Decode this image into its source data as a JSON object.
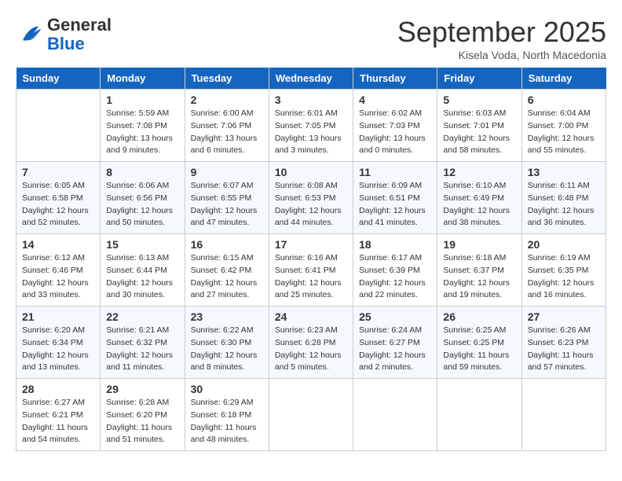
{
  "header": {
    "logo": {
      "line1": "General",
      "line2": "Blue"
    },
    "month": "September 2025",
    "location": "Kisela Voda, North Macedonia"
  },
  "days_of_week": [
    "Sunday",
    "Monday",
    "Tuesday",
    "Wednesday",
    "Thursday",
    "Friday",
    "Saturday"
  ],
  "weeks": [
    [
      {
        "day": "",
        "info": ""
      },
      {
        "day": "1",
        "info": "Sunrise: 5:59 AM\nSunset: 7:08 PM\nDaylight: 13 hours\nand 9 minutes."
      },
      {
        "day": "2",
        "info": "Sunrise: 6:00 AM\nSunset: 7:06 PM\nDaylight: 13 hours\nand 6 minutes."
      },
      {
        "day": "3",
        "info": "Sunrise: 6:01 AM\nSunset: 7:05 PM\nDaylight: 13 hours\nand 3 minutes."
      },
      {
        "day": "4",
        "info": "Sunrise: 6:02 AM\nSunset: 7:03 PM\nDaylight: 13 hours\nand 0 minutes."
      },
      {
        "day": "5",
        "info": "Sunrise: 6:03 AM\nSunset: 7:01 PM\nDaylight: 12 hours\nand 58 minutes."
      },
      {
        "day": "6",
        "info": "Sunrise: 6:04 AM\nSunset: 7:00 PM\nDaylight: 12 hours\nand 55 minutes."
      }
    ],
    [
      {
        "day": "7",
        "info": "Sunrise: 6:05 AM\nSunset: 6:58 PM\nDaylight: 12 hours\nand 52 minutes."
      },
      {
        "day": "8",
        "info": "Sunrise: 6:06 AM\nSunset: 6:56 PM\nDaylight: 12 hours\nand 50 minutes."
      },
      {
        "day": "9",
        "info": "Sunrise: 6:07 AM\nSunset: 6:55 PM\nDaylight: 12 hours\nand 47 minutes."
      },
      {
        "day": "10",
        "info": "Sunrise: 6:08 AM\nSunset: 6:53 PM\nDaylight: 12 hours\nand 44 minutes."
      },
      {
        "day": "11",
        "info": "Sunrise: 6:09 AM\nSunset: 6:51 PM\nDaylight: 12 hours\nand 41 minutes."
      },
      {
        "day": "12",
        "info": "Sunrise: 6:10 AM\nSunset: 6:49 PM\nDaylight: 12 hours\nand 38 minutes."
      },
      {
        "day": "13",
        "info": "Sunrise: 6:11 AM\nSunset: 6:48 PM\nDaylight: 12 hours\nand 36 minutes."
      }
    ],
    [
      {
        "day": "14",
        "info": "Sunrise: 6:12 AM\nSunset: 6:46 PM\nDaylight: 12 hours\nand 33 minutes."
      },
      {
        "day": "15",
        "info": "Sunrise: 6:13 AM\nSunset: 6:44 PM\nDaylight: 12 hours\nand 30 minutes."
      },
      {
        "day": "16",
        "info": "Sunrise: 6:15 AM\nSunset: 6:42 PM\nDaylight: 12 hours\nand 27 minutes."
      },
      {
        "day": "17",
        "info": "Sunrise: 6:16 AM\nSunset: 6:41 PM\nDaylight: 12 hours\nand 25 minutes."
      },
      {
        "day": "18",
        "info": "Sunrise: 6:17 AM\nSunset: 6:39 PM\nDaylight: 12 hours\nand 22 minutes."
      },
      {
        "day": "19",
        "info": "Sunrise: 6:18 AM\nSunset: 6:37 PM\nDaylight: 12 hours\nand 19 minutes."
      },
      {
        "day": "20",
        "info": "Sunrise: 6:19 AM\nSunset: 6:35 PM\nDaylight: 12 hours\nand 16 minutes."
      }
    ],
    [
      {
        "day": "21",
        "info": "Sunrise: 6:20 AM\nSunset: 6:34 PM\nDaylight: 12 hours\nand 13 minutes."
      },
      {
        "day": "22",
        "info": "Sunrise: 6:21 AM\nSunset: 6:32 PM\nDaylight: 12 hours\nand 11 minutes."
      },
      {
        "day": "23",
        "info": "Sunrise: 6:22 AM\nSunset: 6:30 PM\nDaylight: 12 hours\nand 8 minutes."
      },
      {
        "day": "24",
        "info": "Sunrise: 6:23 AM\nSunset: 6:28 PM\nDaylight: 12 hours\nand 5 minutes."
      },
      {
        "day": "25",
        "info": "Sunrise: 6:24 AM\nSunset: 6:27 PM\nDaylight: 12 hours\nand 2 minutes."
      },
      {
        "day": "26",
        "info": "Sunrise: 6:25 AM\nSunset: 6:25 PM\nDaylight: 11 hours\nand 59 minutes."
      },
      {
        "day": "27",
        "info": "Sunrise: 6:26 AM\nSunset: 6:23 PM\nDaylight: 11 hours\nand 57 minutes."
      }
    ],
    [
      {
        "day": "28",
        "info": "Sunrise: 6:27 AM\nSunset: 6:21 PM\nDaylight: 11 hours\nand 54 minutes."
      },
      {
        "day": "29",
        "info": "Sunrise: 6:28 AM\nSunset: 6:20 PM\nDaylight: 11 hours\nand 51 minutes."
      },
      {
        "day": "30",
        "info": "Sunrise: 6:29 AM\nSunset: 6:18 PM\nDaylight: 11 hours\nand 48 minutes."
      },
      {
        "day": "",
        "info": ""
      },
      {
        "day": "",
        "info": ""
      },
      {
        "day": "",
        "info": ""
      },
      {
        "day": "",
        "info": ""
      }
    ]
  ]
}
